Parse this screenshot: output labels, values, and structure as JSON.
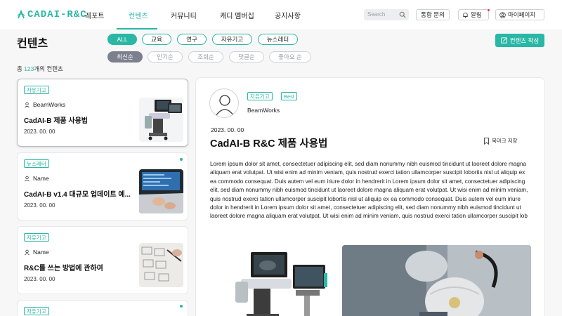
{
  "nav": {
    "logo": "CADAI-R&C",
    "items": [
      "레포트",
      "컨텐츠",
      "커뮤니티",
      "캐디 멤버십",
      "공지사항"
    ],
    "search_placeholder": "Search",
    "inquiry": "통합 문의",
    "alert": "알림",
    "mypage": "마이페이지"
  },
  "page": {
    "title": "컨텐츠",
    "write_button": "컨텐츠 작성",
    "count_prefix": "총 ",
    "count": "123",
    "count_suffix": "개의 컨텐츠"
  },
  "filters": [
    "ALL",
    "교육",
    "연구",
    "자유기고",
    "뉴스레터"
  ],
  "sorts": [
    "최신순",
    "인기순",
    "조회순",
    "댓글순",
    "좋아요 순"
  ],
  "cards": [
    {
      "tag": "자유기고",
      "author": "BeamWorks",
      "title": "CadAI-B 제품 사용법",
      "date": "2023. 00. 00"
    },
    {
      "tag": "뉴스레터",
      "author": "Name",
      "title": "CadAI-B v1.4 대규모 업데이트 예...",
      "date": "2023. 00. 00"
    },
    {
      "tag": "자유기고",
      "author": "Name",
      "title": "R&C를 쓰는 방법에 관하여",
      "date": "2023. 00. 00"
    },
    {
      "tag": "자유기고"
    }
  ],
  "detail": {
    "tags": [
      "자유기고",
      "Best"
    ],
    "author": "BeamWorks",
    "date": "2023. 00. 00",
    "title": "CadAI-B R&C 제품 사용법",
    "bookmark": "북마크 저장",
    "body": "Lorem ipsum dolor sit amet, consectetuer adipiscing elit, sed diam nonummy nibh euismod tincidunt ut laoreet dolore magna aliquam erat volutpat. Ut wisi enim ad minim veniam, quis nostrud exerci tation ullamcorper suscipit lobortis nisl ut aliquip ex ea commodo consequat. Duis autem vel eum iriure dolor in hendrerit in Lorem ipsum dolor sit amet, consectetuer adipiscing elit, sed diam nonummy nibh euismod tincidunt ut laoreet dolore magna aliquam erat volutpat. Ut wisi enim ad minim veniam, quis nostrud exerci tation ullamcorper suscipit lobortis nisl ut aliquip ex ea commodo consequat. Duis autem vel eum iriure dolor in hendrerit in Lorem ipsum dolor sit amet, consectetuer adipiscing elit, sed diam nonummy nibh euismod tincidunt ut laoreet dolore magna aliquam erat volutpat. Ut wisi enim ad minim veniam, quis nostrud exerci tation ullamcorper suscipit lob"
  },
  "colors": {
    "accent": "#2ab7a5",
    "sort_active": "#7b7f8e",
    "alert_dot": "#e53935"
  }
}
